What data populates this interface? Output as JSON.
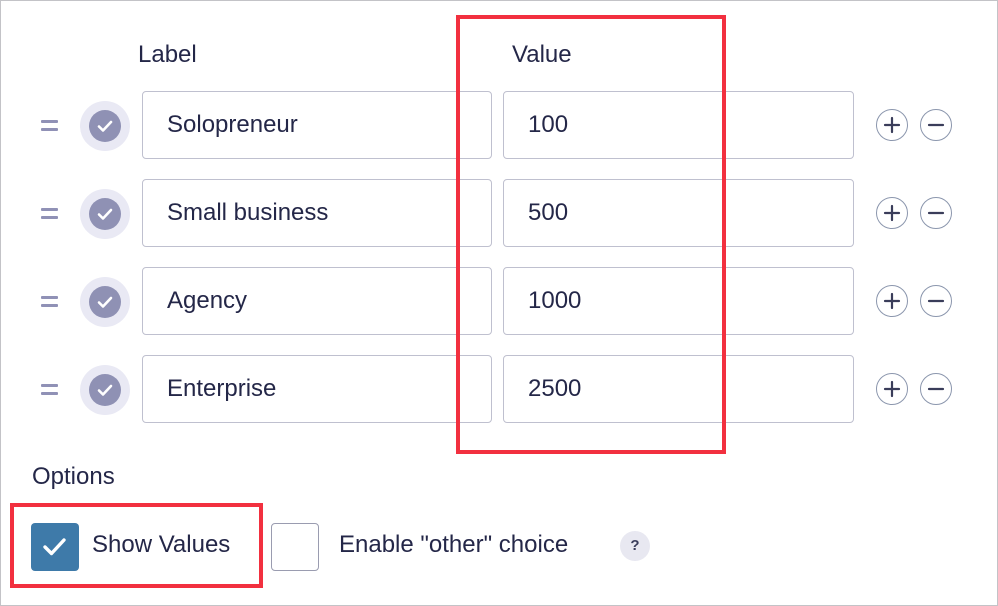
{
  "headers": {
    "label": "Label",
    "value": "Value"
  },
  "choices": [
    {
      "label": "Solopreneur",
      "value": "100"
    },
    {
      "label": "Small business",
      "value": "500"
    },
    {
      "label": "Agency",
      "value": "1000"
    },
    {
      "label": "Enterprise",
      "value": "2500"
    }
  ],
  "options": {
    "title": "Options",
    "show_values": {
      "label": "Show Values",
      "checked": true
    },
    "enable_other": {
      "label": "Enable \"other\" choice",
      "checked": false
    },
    "help": "?"
  },
  "icons": {
    "drag": "drag-handle-icon",
    "check": "check-icon",
    "add": "plus-icon",
    "remove": "minus-icon"
  },
  "colors": {
    "accent": "#3e7aa9",
    "highlight": "#f2303f",
    "toggle": "#8f91b4",
    "text": "#242748"
  }
}
